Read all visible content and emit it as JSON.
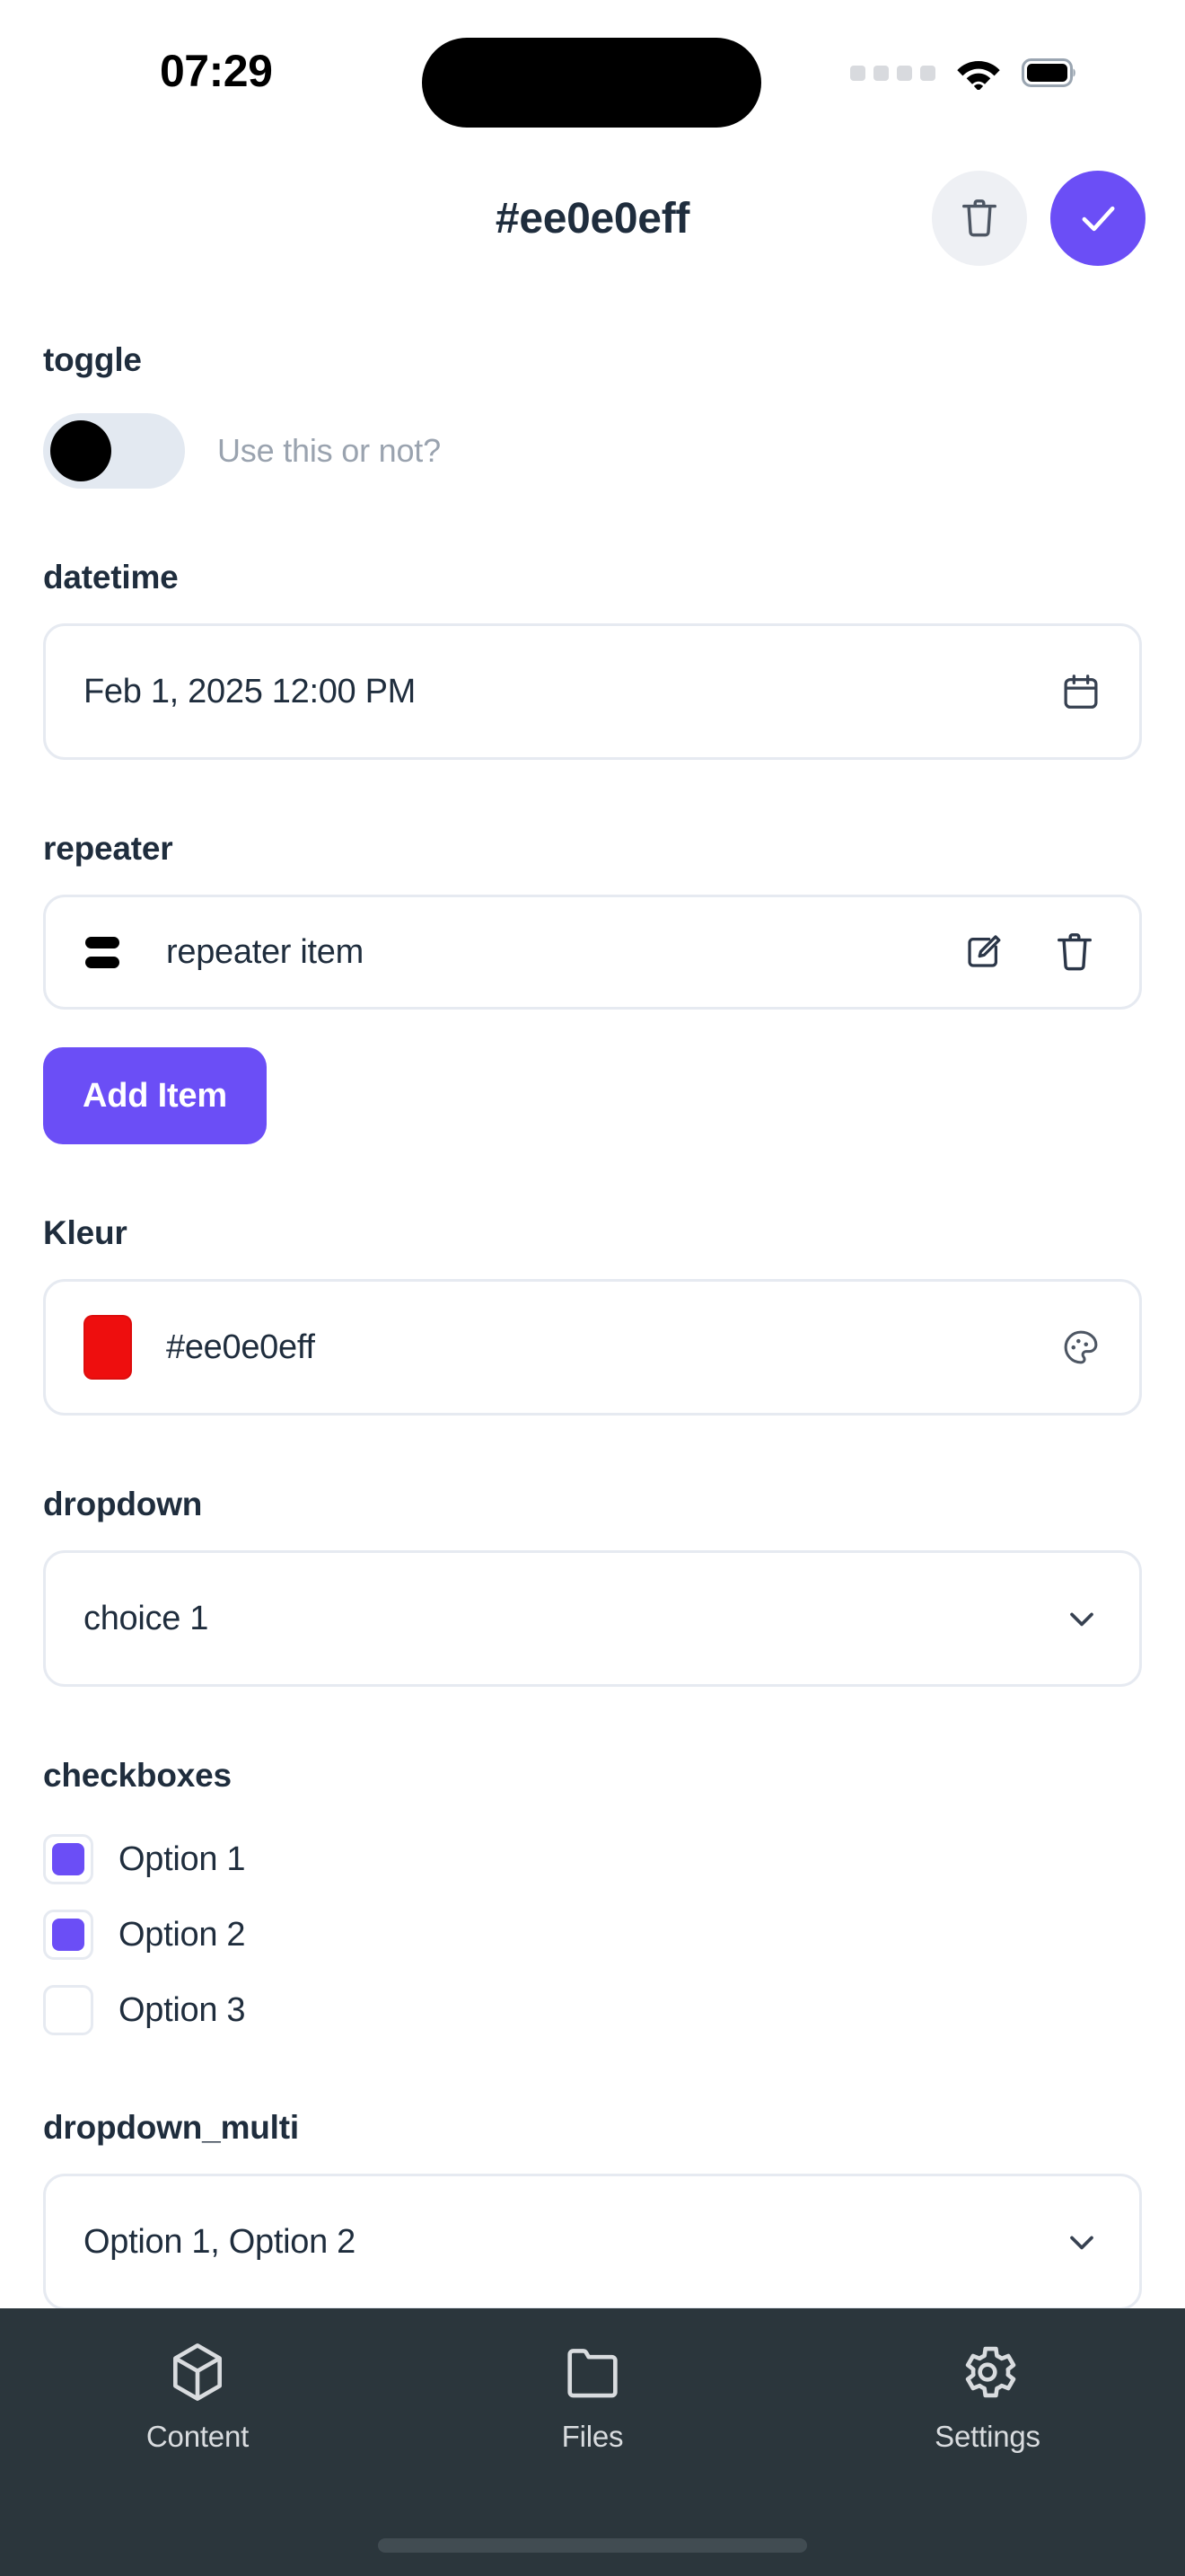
{
  "status_bar": {
    "time": "07:29",
    "signal_icon": "signal-dots-icon",
    "wifi_icon": "wifi-icon",
    "battery_icon": "battery-full-icon"
  },
  "header": {
    "title": "#ee0e0eff",
    "delete_icon": "trash-icon",
    "confirm_icon": "check-icon",
    "accent_color": "#6b4ef6",
    "delete_bg_color": "#eef0f4"
  },
  "fields": {
    "toggle": {
      "label": "toggle",
      "hint": "Use this or not?",
      "checked": false
    },
    "datetime": {
      "label": "datetime",
      "value": "Feb 1, 2025 12:00 PM",
      "icon": "calendar-icon"
    },
    "repeater": {
      "label": "repeater",
      "items": [
        {
          "text": "repeater item",
          "drag_icon": "drag-handle-icon",
          "edit_icon": "edit-pencil-icon",
          "delete_icon": "trash-icon"
        }
      ],
      "add_button_label": "Add Item"
    },
    "kleur": {
      "label": "Kleur",
      "value": "#ee0e0eff",
      "swatch_color": "#ee0e0e",
      "icon": "palette-icon"
    },
    "dropdown": {
      "label": "dropdown",
      "value": "choice 1",
      "icon": "chevron-down-icon"
    },
    "checkboxes": {
      "label": "checkboxes",
      "options": [
        {
          "label": "Option 1",
          "checked": true
        },
        {
          "label": "Option 2",
          "checked": true
        },
        {
          "label": "Option 3",
          "checked": false
        }
      ]
    },
    "dropdown_multi": {
      "label": "dropdown_multi",
      "value": "Option 1, Option 2",
      "icon": "chevron-down-icon"
    }
  },
  "bottom_nav": {
    "items": [
      {
        "label": "Content",
        "icon": "cube-icon"
      },
      {
        "label": "Files",
        "icon": "folder-icon"
      },
      {
        "label": "Settings",
        "icon": "gear-icon"
      }
    ],
    "background_color": "#2b363c"
  }
}
